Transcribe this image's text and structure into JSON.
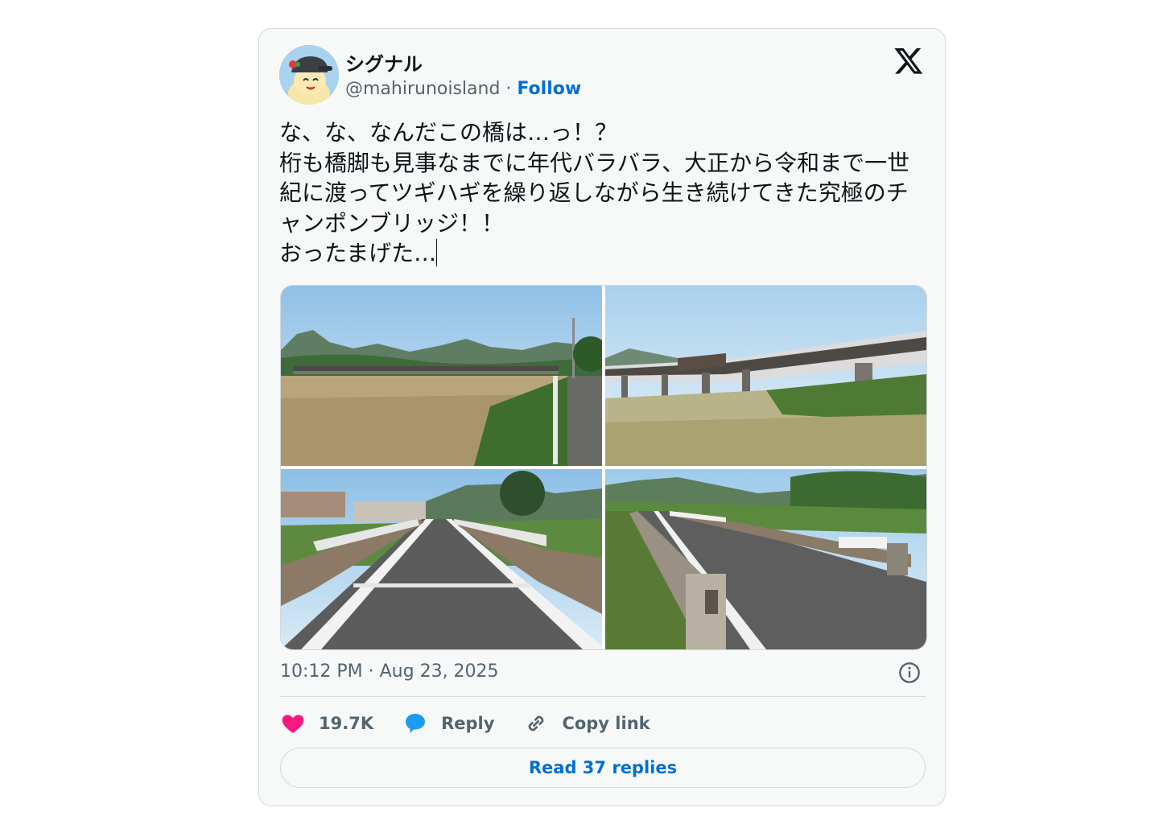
{
  "author": {
    "name": "シグナル",
    "handle": "@mahirunoisland",
    "separator": " · ",
    "follow_label": "Follow"
  },
  "logo": "x-logo-icon",
  "tweet": {
    "text": "な、な、なんだこの橋は…っ！？\n桁も橋脚も見事なまでに年代バラバラ、大正から令和まで一世紀に渡ってツギハギを繰り返しながら生き続けてきた究極のチャンポンブリッジ！！\nおったまげた…"
  },
  "media": {
    "photos": [
      {
        "subject": "wide field with long low bridge and mountains"
      },
      {
        "subject": "bridge deck spans on concrete piers"
      },
      {
        "subject": "view down bridge roadway between railings"
      },
      {
        "subject": "bridge roadway with concrete parapet and guardrail"
      }
    ]
  },
  "meta": {
    "timestamp": "10:12 PM · Aug 23, 2025"
  },
  "actions": {
    "likes": "19.7K",
    "reply_label": "Reply",
    "copy_link_label": "Copy link",
    "read_replies_label": "Read 37 replies"
  },
  "colors": {
    "accent": "#006fd6",
    "like": "#f91880",
    "reply": "#1d9bf0",
    "text": "#0f1419",
    "muted": "#536471"
  }
}
